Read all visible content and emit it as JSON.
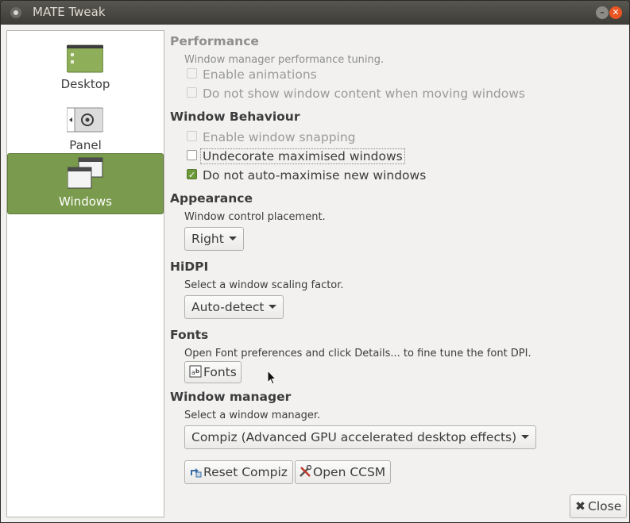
{
  "window": {
    "title": "MATE Tweak"
  },
  "sidebar": {
    "items": [
      {
        "label": "Desktop",
        "icon": "desktop-icon",
        "active": false
      },
      {
        "label": "Panel",
        "icon": "panel-icon",
        "active": false
      },
      {
        "label": "Windows",
        "icon": "windows-icon",
        "active": true
      }
    ]
  },
  "performance": {
    "heading": "Performance",
    "description": "Window manager performance tuning.",
    "enable_animations": {
      "label": "Enable animations",
      "checked": false,
      "enabled": false
    },
    "no_content_move": {
      "label": "Do not show window content when moving windows",
      "checked": false,
      "enabled": false
    }
  },
  "behaviour": {
    "heading": "Window Behaviour",
    "snapping": {
      "label": "Enable window snapping",
      "checked": false,
      "enabled": false
    },
    "undecorate": {
      "label": "Undecorate maximised windows",
      "checked": false,
      "enabled": true
    },
    "no_automax": {
      "label": "Do not auto-maximise new windows",
      "checked": true,
      "enabled": true
    }
  },
  "appearance": {
    "heading": "Appearance",
    "description": "Window control placement.",
    "placement_value": "Right"
  },
  "hidpi": {
    "heading": "HiDPI",
    "description": "Select a window scaling factor.",
    "scaling_value": "Auto-detect"
  },
  "fonts": {
    "heading": "Fonts",
    "description": "Open Font preferences and click Details... to fine tune the font DPI.",
    "button_label": "Fonts"
  },
  "wm": {
    "heading": "Window manager",
    "description": "Select a window manager.",
    "selected": "Compiz (Advanced GPU accelerated desktop effects)",
    "reset_label": "Reset Compiz",
    "ccsm_label": "Open CCSM"
  },
  "footer": {
    "close_label": "Close"
  },
  "colors": {
    "accent": "#7a9b4d",
    "close_button": "#e95420"
  }
}
